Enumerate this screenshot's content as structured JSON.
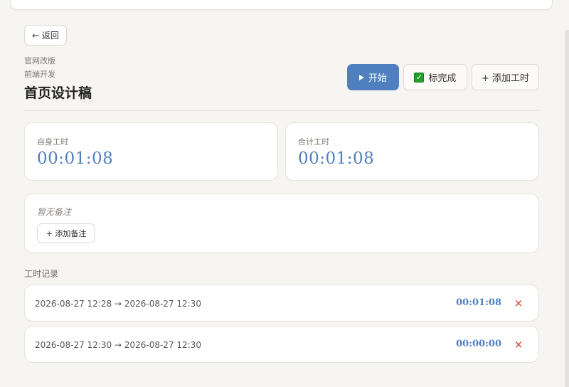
{
  "nav": {
    "back_label": "← 返回"
  },
  "breadcrumb": {
    "project": "官网改版",
    "group": "前端开发"
  },
  "task": {
    "title": "首页设计稿"
  },
  "actions": {
    "start_label": "开始",
    "done_label": "标完成",
    "add_time_label": "+ 添加工时"
  },
  "stats": {
    "self_label": "自身工时",
    "self_value": "00:01:08",
    "total_label": "合计工时",
    "total_value": "00:01:08"
  },
  "note": {
    "empty_text": "暂无备注",
    "add_label": "+ 添加备注"
  },
  "logs": {
    "title": "工时记录",
    "items": [
      {
        "range": "2026-08-27 12:28 → 2026-08-27 12:30",
        "duration": "00:01:08",
        "delete_icon": "×"
      },
      {
        "range": "2026-08-27 12:30 → 2026-08-27 12:30",
        "duration": "00:00:00",
        "delete_icon": "×"
      }
    ]
  },
  "colors": {
    "accent": "#4f7fbf",
    "danger": "#d0322d",
    "check": "#22a12a",
    "background": "#f7f5f1"
  }
}
